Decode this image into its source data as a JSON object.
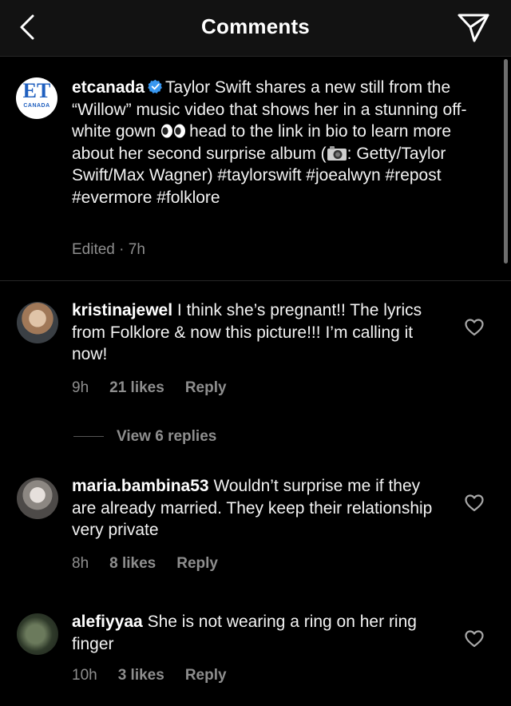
{
  "header": {
    "title": "Comments",
    "back_icon": "chevron-left-icon",
    "share_icon": "paper-plane-icon"
  },
  "caption": {
    "username": "etcanada",
    "avatar_text": "ET",
    "avatar_sub": "CANADA",
    "text_1": "Taylor Swift shares a new still from the “Willow” music video that shows her in a stunning off-white gown",
    "text_2": "head to the link in bio to learn more about her second surprise album (",
    "text_3": ": Getty/Taylor Swift/Max Wagner) #taylorswift #joealwyn #repost #evermore #folklore",
    "meta": "Edited · 7h"
  },
  "comments": [
    {
      "username": "kristinajewel",
      "text": "I think she’s pregnant!! The lyrics from Folklore & now this picture!!! I’m calling it now!",
      "time": "9h",
      "likes": "21 likes",
      "reply": "Reply",
      "view_replies": "View 6 replies"
    },
    {
      "username": "maria.bambina53",
      "text": "Wouldn’t surprise me if they are already married.  They keep their relationship very private",
      "time": "8h",
      "likes": "8 likes",
      "reply": "Reply"
    },
    {
      "username": "alefiyyaa",
      "text": "She is not wearing a ring on her ring finger",
      "time": "10h",
      "likes": "3 likes",
      "reply": "Reply"
    }
  ],
  "colors": {
    "background": "#000000",
    "header_bg": "#121212",
    "text": "#f2f2f2",
    "muted": "#8e8e8e",
    "verified": "#3897f0",
    "et_blue": "#1f5fbf"
  }
}
